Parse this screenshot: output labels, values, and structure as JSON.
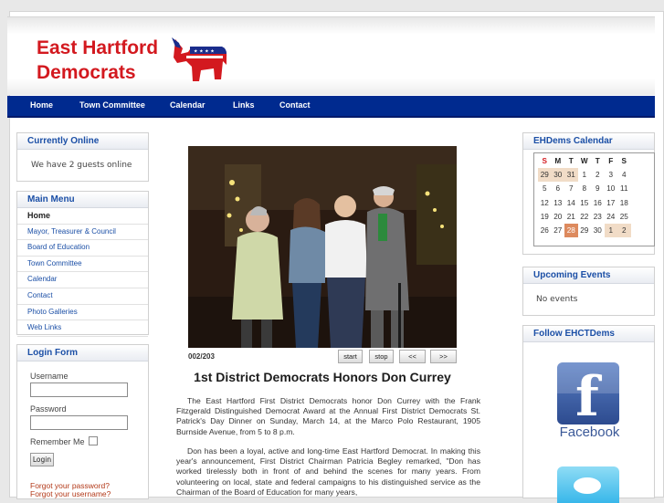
{
  "header": {
    "logo_line1": "East Hartford",
    "logo_line2": "Democrats"
  },
  "nav": [
    "Home",
    "Town Committee",
    "Calendar",
    "Links",
    "Contact"
  ],
  "currently_online": {
    "title": "Currently Online",
    "text": "We have 2 guests online"
  },
  "main_menu": {
    "title": "Main Menu",
    "items": [
      "Home",
      "Mayor, Treasurer & Council",
      "Board of Education",
      "Town Committee",
      "Calendar",
      "Contact",
      "Photo Galleries",
      "Web Links"
    ]
  },
  "login": {
    "title": "Login Form",
    "username_label": "Username",
    "password_label": "Password",
    "remember_label": "Remember Me",
    "button": "Login",
    "forgot_password": "Forgot your password?",
    "forgot_username": "Forgot your username?"
  },
  "gallery": {
    "counter": "002/203",
    "buttons": [
      "start",
      "stop",
      "<<",
      ">>"
    ]
  },
  "article": {
    "title": "1st District Democrats Honors Don Currey",
    "p1": "The East Hartford First District Democrats honor Don Currey with the Frank Fitzgerald Distinguished Democrat Award at the Annual First District Democrats St. Patrick's Day Dinner on Sunday, March 14, at the Marco Polo Restaurant, 1905 Burnside Avenue, from 5 to 8 p.m.",
    "p2": "Don has been a loyal, active and long-time East Hartford Democrat. In making this year's announcement, First District Chairman Patricia Begley remarked, \"Don has worked tirelessly both in front of and behind the scenes for many years. From volunteering on local, state and federal campaigns to his distinguished service as the Chairman of the Board of Education for many years,"
  },
  "calendar": {
    "title": "EHDems Calendar",
    "days": [
      "S",
      "M",
      "T",
      "W",
      "T",
      "F",
      "S"
    ],
    "weeks": [
      [
        "29",
        "30",
        "31",
        "1",
        "2",
        "3",
        "4"
      ],
      [
        "5",
        "6",
        "7",
        "8",
        "9",
        "10",
        "11"
      ],
      [
        "12",
        "13",
        "14",
        "15",
        "16",
        "17",
        "18"
      ],
      [
        "19",
        "20",
        "21",
        "22",
        "23",
        "24",
        "25"
      ],
      [
        "26",
        "27",
        "28",
        "29",
        "30",
        "1",
        "2"
      ]
    ],
    "today": "28"
  },
  "upcoming": {
    "title": "Upcoming Events",
    "text": "No events"
  },
  "follow": {
    "title": "Follow EHCTDems",
    "facebook_label": "Facebook"
  },
  "colors": {
    "brand_red": "#d3191f",
    "nav_blue": "#002a8f",
    "link_blue": "#1b4fa6"
  }
}
